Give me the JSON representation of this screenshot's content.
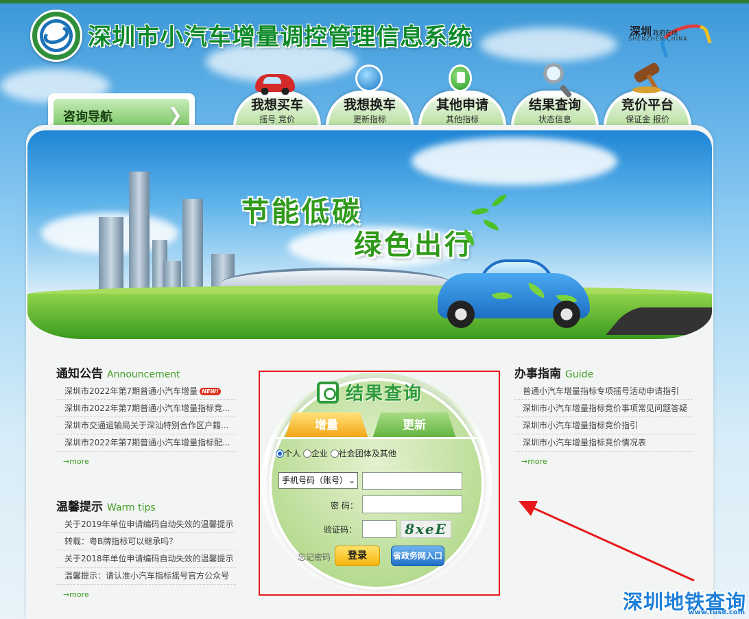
{
  "header": {
    "title": "深圳市小汽车增量调控管理信息系统",
    "sz_logo_cn": "深圳",
    "sz_logo_sub": "政府在线",
    "sz_logo_en": "SHENZHEN CHINA"
  },
  "nav": {
    "consult_label": "咨询导航",
    "tabs": [
      {
        "title": "我想买车",
        "sub": "摇号  竞价",
        "icon": "red-car-icon"
      },
      {
        "title": "我想换车",
        "sub": "更新指标",
        "icon": "refresh-globe-icon"
      },
      {
        "title": "其他申请",
        "sub": "其他指标",
        "icon": "document-icon"
      },
      {
        "title": "结果查询",
        "sub": "状态信息",
        "icon": "magnifier-icon"
      },
      {
        "title": "竞价平台",
        "sub": "保证金  报价",
        "icon": "gavel-icon"
      }
    ]
  },
  "banner": {
    "slogan1": "节能低碳",
    "slogan2": "绿色出行"
  },
  "notice": {
    "title": "通知公告",
    "title_en": "Announcement",
    "items": [
      "深圳市2022年第7期普通小汽车增量",
      "深圳市2022年第7期普通小汽车增量指标竞...",
      "深圳市交通运输局关于深汕特别合作区户籍...",
      "深圳市2022年第7期普通小汽车增量指标配..."
    ],
    "new_badge": "NEW!",
    "more": "more"
  },
  "tips": {
    "title": "温馨提示",
    "title_en": "Warm tips",
    "items": [
      "关于2019年单位申请编码自动失效的温馨提示",
      "转载：粤B牌指标可以继承吗？",
      "关于2018年单位申请编码自动失效的温馨提示",
      "温馨提示：请认准小汽车指标摇号官方公众号"
    ],
    "more": "more"
  },
  "guide": {
    "title": "办事指南",
    "title_en": "Guide",
    "items": [
      "普通小汽车增量指标专项摇号活动申请指引",
      "深圳市小汽车增量指标竞价事项常见问题答疑",
      "深圳市小汽车增量指标竞价指引",
      "深圳市小汽车增量指标竞价情况表"
    ],
    "more": "more"
  },
  "login": {
    "title": "结果查询",
    "tab_increment": "增量",
    "tab_renew": "更新",
    "radio_personal": "个人",
    "radio_company": "企业",
    "radio_org": "社会团体及其他",
    "account_type": "手机号码（账号）",
    "account_value": "",
    "password_label": "密  码：",
    "password_value": "",
    "captcha_label": "验证码：",
    "captcha_value": "",
    "captcha_text": "8xeE",
    "forgot": "忘记密码",
    "login_btn": "登录",
    "gov_btn": "省政务网入口"
  },
  "watermark": {
    "text": "深圳地铁查询",
    "url": "www.tus8.com"
  }
}
